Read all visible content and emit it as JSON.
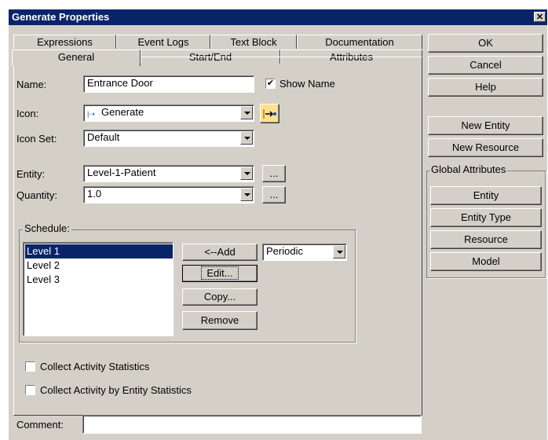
{
  "window": {
    "title": "Generate Properties",
    "close_glyph": "✕"
  },
  "tabs": {
    "row_back": [
      "Expressions",
      "Event Logs",
      "Text Block",
      "Documentation"
    ],
    "row_front": [
      "General",
      "Start/End",
      "Attributes"
    ],
    "active": "General"
  },
  "general": {
    "name_label": "Name:",
    "name_value": "Entrance Door",
    "show_name_label": "Show Name",
    "show_name_checked": true,
    "icon_label": "Icon:",
    "icon_value": "Generate",
    "icon_set_label": "Icon Set:",
    "icon_set_value": "Default",
    "entity_label": "Entity:",
    "entity_value": "Level-1-Patient",
    "quantity_label": "Quantity:",
    "quantity_value": "1.0",
    "ellipsis": "...",
    "schedule_label": "Schedule:",
    "schedule_items": [
      "Level 1",
      "Level 2",
      "Level 3"
    ],
    "schedule_selected": "Level 1",
    "add_button": "<--Add",
    "edit_button": "Edit...",
    "copy_button": "Copy...",
    "remove_button": "Remove",
    "schedule_type": "Periodic",
    "collect_activity_label": "Collect Activity Statistics",
    "collect_entity_label": "Collect Activity by Entity Statistics",
    "comment_label": "Comment:",
    "comment_value": ""
  },
  "side": {
    "ok": "OK",
    "cancel": "Cancel",
    "help": "Help",
    "new_entity": "New Entity",
    "new_resource": "New Resource",
    "global_attributes_label": "Global Attributes",
    "entity": "Entity",
    "entity_type": "Entity Type",
    "resource": "Resource",
    "model": "Model"
  },
  "colors": {
    "title_bar": "#0a246a",
    "dialog_bg": "#d4d0c8",
    "selection": "#0a246a"
  }
}
